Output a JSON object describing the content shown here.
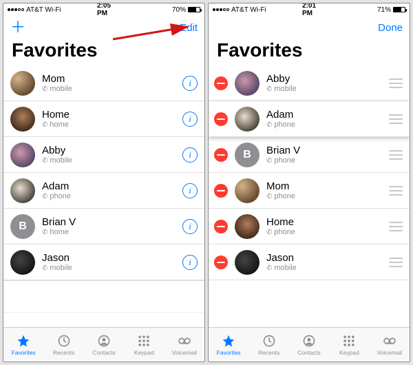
{
  "left": {
    "status": {
      "carrier": "AT&T Wi-Fi",
      "time": "2:05 PM",
      "battery_pct": "70%",
      "battery_fill": 70
    },
    "nav": {
      "left": "＋",
      "right": "Edit"
    },
    "title": "Favorites",
    "contacts": [
      {
        "name": "Mom",
        "sub": "mobile",
        "avatar": "av-mom",
        "letter": ""
      },
      {
        "name": "Home",
        "sub": "home",
        "avatar": "av-home",
        "letter": ""
      },
      {
        "name": "Abby",
        "sub": "mobile",
        "avatar": "av-abby",
        "letter": ""
      },
      {
        "name": "Adam",
        "sub": "phone",
        "avatar": "av-adam",
        "letter": ""
      },
      {
        "name": "Brian V",
        "sub": "home",
        "avatar": "av-letter",
        "letter": "B"
      },
      {
        "name": "Jason",
        "sub": "mobile",
        "avatar": "av-jason",
        "letter": ""
      }
    ]
  },
  "right": {
    "status": {
      "carrier": "AT&T Wi-Fi",
      "time": "2:01 PM",
      "battery_pct": "71%",
      "battery_fill": 71
    },
    "nav": {
      "left": "",
      "right": "Done"
    },
    "title": "Favorites",
    "contacts": [
      {
        "name": "Abby",
        "sub": "mobile",
        "avatar": "av-abby",
        "letter": "",
        "dragging": false
      },
      {
        "name": "Adam",
        "sub": "phone",
        "avatar": "av-adam",
        "letter": "",
        "dragging": true
      },
      {
        "name": "Brian V",
        "sub": "phone",
        "avatar": "av-letter",
        "letter": "B",
        "dragging": false
      },
      {
        "name": "Mom",
        "sub": "phone",
        "avatar": "av-mom",
        "letter": "",
        "dragging": false
      },
      {
        "name": "Home",
        "sub": "phone",
        "avatar": "av-home",
        "letter": "",
        "dragging": false
      },
      {
        "name": "Jason",
        "sub": "mobile",
        "avatar": "av-jason",
        "letter": "",
        "dragging": false
      }
    ]
  },
  "tabs": [
    {
      "id": "favorites",
      "label": "Favorites",
      "active": true
    },
    {
      "id": "recents",
      "label": "Recents",
      "active": false
    },
    {
      "id": "contacts",
      "label": "Contacts",
      "active": false
    },
    {
      "id": "keypad",
      "label": "Keypad",
      "active": false
    },
    {
      "id": "voicemail",
      "label": "Voicemail",
      "active": false
    }
  ]
}
